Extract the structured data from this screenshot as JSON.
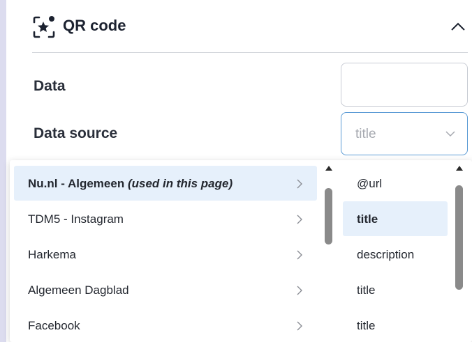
{
  "panel": {
    "title": "QR code",
    "icon": "qr-sparkle-icon",
    "collapse_icon": "chevron-up-icon"
  },
  "form": {
    "data_label": "Data",
    "data_value": "",
    "data_source_label": "Data source",
    "data_source_value": "title"
  },
  "sources": [
    {
      "label": "Nu.nl - Algemeen ",
      "note": "(used in this page)",
      "selected": true
    },
    {
      "label": "TDM5 - Instagram",
      "note": "",
      "selected": false
    },
    {
      "label": "Harkema",
      "note": "",
      "selected": false
    },
    {
      "label": "Algemeen Dagblad",
      "note": "",
      "selected": false
    },
    {
      "label": "Facebook",
      "note": "",
      "selected": false
    }
  ],
  "fields": [
    {
      "label": "@url",
      "selected": false
    },
    {
      "label": "title",
      "selected": true
    },
    {
      "label": "description",
      "selected": false
    },
    {
      "label": "title",
      "selected": false
    },
    {
      "label": "title",
      "selected": false
    }
  ],
  "colors": {
    "accent_border": "#5b9bd5",
    "selected_bg": "#e6f0fb",
    "rail": "#dcdcef"
  }
}
